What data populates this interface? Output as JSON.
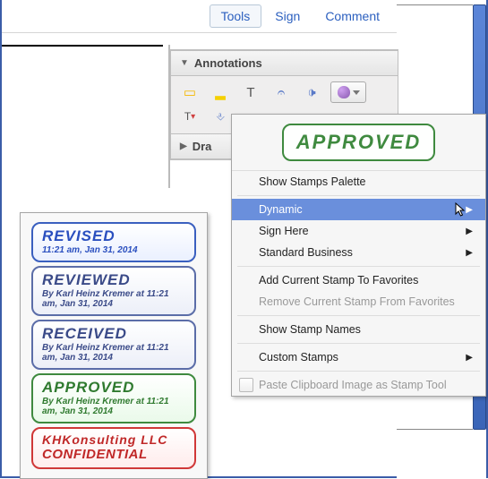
{
  "topbar": {
    "tools": "Tools",
    "sign": "Sign",
    "comment": "Comment"
  },
  "panel": {
    "annotations": "Annotations",
    "drawing": "Dra"
  },
  "preview_stamp": "APPROVED",
  "menu": {
    "show_palette": "Show Stamps Palette",
    "dynamic": "Dynamic",
    "sign_here": "Sign Here",
    "standard_business": "Standard Business",
    "add_fav": "Add Current Stamp To Favorites",
    "remove_fav": "Remove Current Stamp From Favorites",
    "show_names": "Show Stamp Names",
    "custom": "Custom Stamps",
    "paste": "Paste Clipboard Image as Stamp Tool"
  },
  "stamps": {
    "revised": {
      "title": "REVISED",
      "sub": "11:21 am, Jan 31, 2014"
    },
    "reviewed": {
      "title": "REVIEWED",
      "sub": "By Karl Heinz Kremer at 11:21 am, Jan 31, 2014"
    },
    "received": {
      "title": "RECEIVED",
      "sub": "By Karl Heinz Kremer at 11:21 am, Jan 31, 2014"
    },
    "approved": {
      "title": "APPROVED",
      "sub": "By Karl Heinz Kremer at 11:21 am, Jan 31, 2014"
    },
    "conf": {
      "line1": "KHKonsulting LLC",
      "line2": "CONFIDENTIAL"
    }
  }
}
